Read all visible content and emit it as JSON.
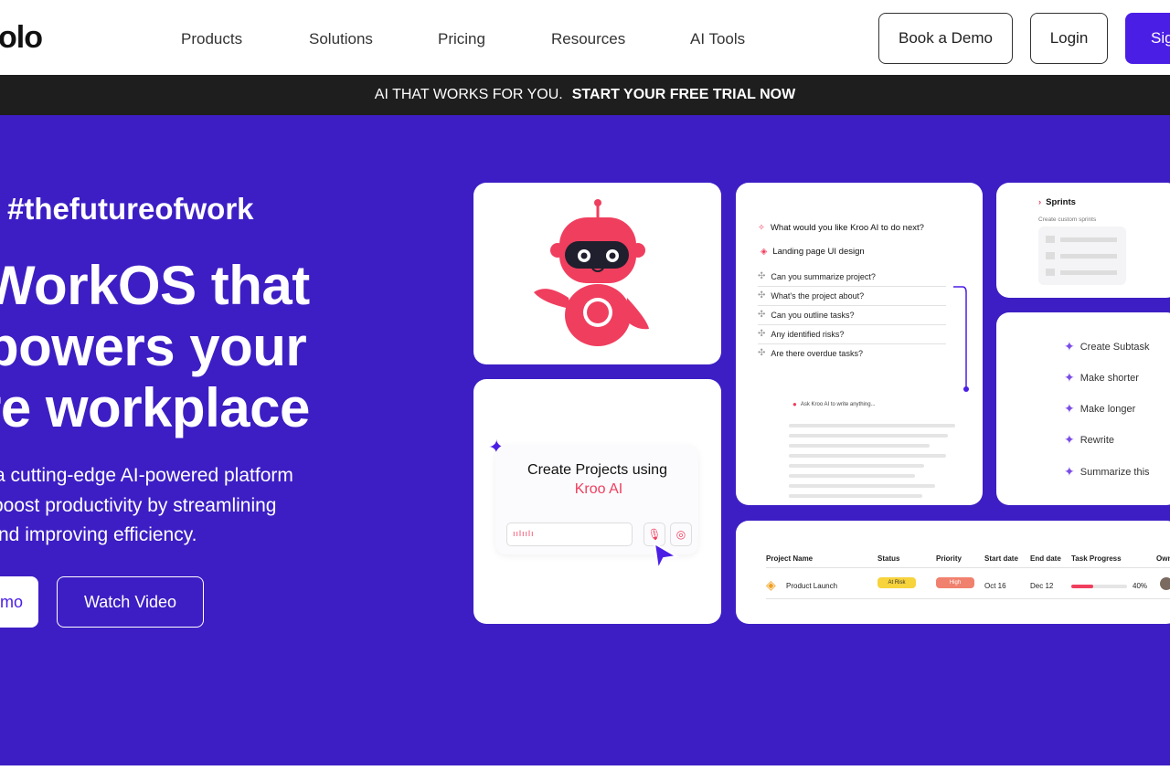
{
  "header": {
    "logo": "olo",
    "nav": [
      "Products",
      "Solutions",
      "Pricing",
      "Resources",
      "AI Tools"
    ],
    "book_demo": "Book a Demo",
    "login": "Login",
    "signup": "Sig"
  },
  "banner": {
    "text": "AI THAT WORKS FOR YOU.",
    "cta": "START YOUR FREE TRIAL NOW"
  },
  "hero": {
    "hashtag": "#thefutureofwork",
    "headline": [
      "WorkOS that",
      "powers your",
      "re workplace"
    ],
    "subtext": [
      "a cutting-edge AI-powered platform",
      "boost productivity by streamlining",
      "nd improving efficiency."
    ],
    "btn_demo": "mo",
    "btn_video": "Watch Video"
  },
  "create_card": {
    "title": "Create Projects using",
    "brand": "Kroo AI"
  },
  "ai_card": {
    "question": "What would you like Kroo AI to do next?",
    "project": "Landing page UI design",
    "prompts": [
      "Can you summarize project?",
      "What's the project about?",
      "Can you outline tasks?",
      "Any identified risks?",
      "Are there overdue tasks?"
    ],
    "ask_placeholder": "Ask Kroo AI to write anything..."
  },
  "sprints_card": {
    "title": "Sprints",
    "subtitle": "Create custom sprints"
  },
  "menu_card": {
    "items": [
      "Create Subtask",
      "Make shorter",
      "Make longer",
      "Rewrite",
      "Summarize this"
    ]
  },
  "table_card": {
    "headers": [
      "Project Name",
      "Status",
      "Priority",
      "Start date",
      "End date",
      "Task Progress",
      "Own"
    ],
    "row": {
      "name": "Product Launch",
      "status": "At Risk",
      "priority": "High",
      "start": "Oct 16",
      "end": "Dec 12",
      "progress": 0.4,
      "progress_label": "40%"
    }
  },
  "colors": {
    "brand": "#4b1ee6",
    "hero_bg": "#3d1ec4",
    "accent_red": "#f03e5e",
    "status_yellow": "#f7d33c",
    "priority_salmon": "#f0816e"
  }
}
